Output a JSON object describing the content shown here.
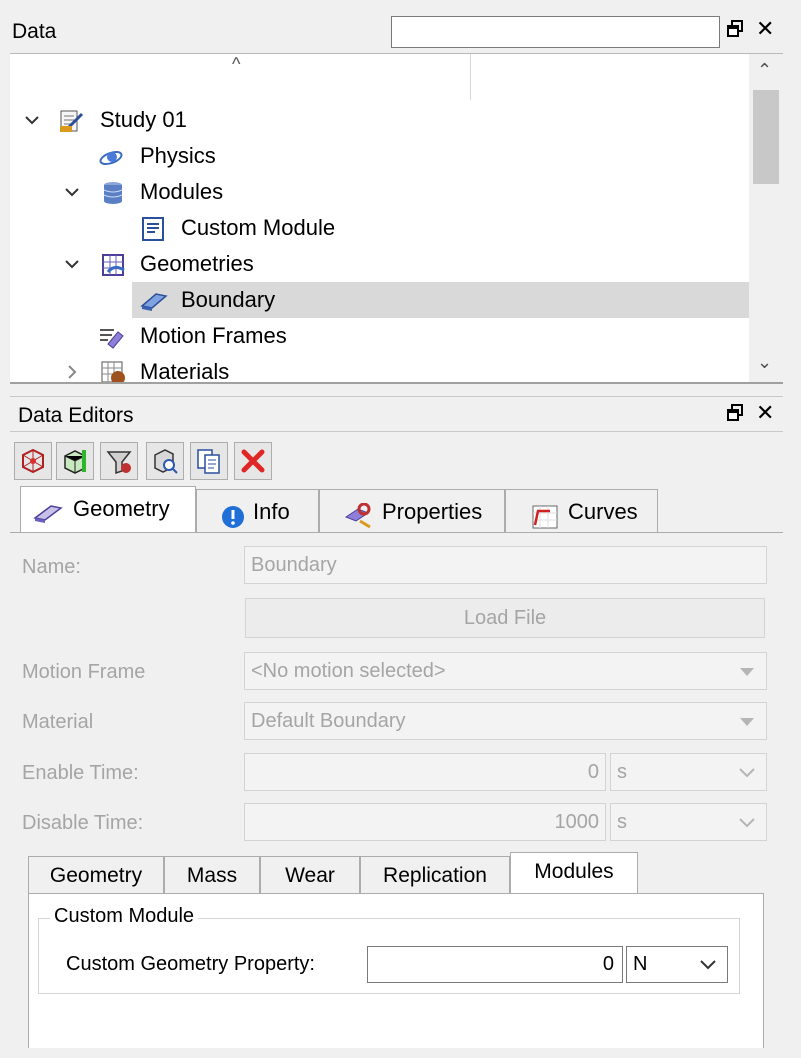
{
  "data_panel": {
    "title": "Data",
    "search_value": "",
    "tree": [
      {
        "label": "Study 01",
        "icon": "study-icon",
        "expanded": true
      },
      {
        "label": "Physics",
        "icon": "physics-icon"
      },
      {
        "label": "Modules",
        "icon": "modules-icon",
        "expanded": true
      },
      {
        "label": "Custom Module",
        "icon": "module-doc-icon"
      },
      {
        "label": "Geometries",
        "icon": "geometries-icon",
        "expanded": true
      },
      {
        "label": "Boundary",
        "icon": "boundary-icon",
        "selected": true
      },
      {
        "label": "Motion Frames",
        "icon": "motion-frames-icon"
      },
      {
        "label": "Materials",
        "icon": "materials-icon",
        "expanded": false
      }
    ]
  },
  "editors": {
    "title": "Data Editors",
    "toolbar": [
      "mesh-icon",
      "box-icon",
      "funnel-icon",
      "inspect-icon",
      "copy-icon",
      "delete-icon"
    ],
    "tabs": [
      {
        "label": "Geometry",
        "icon": "geometry-tab-icon",
        "active": true
      },
      {
        "label": "Info",
        "icon": "info-icon"
      },
      {
        "label": "Properties",
        "icon": "properties-icon"
      },
      {
        "label": "Curves",
        "icon": "curves-icon"
      }
    ],
    "fields": {
      "name_label": "Name:",
      "name_value": "Boundary",
      "load_file": "Load File",
      "motion_label": "Motion Frame",
      "motion_value": "<No motion selected>",
      "material_label": "Material",
      "material_value": "Default Boundary",
      "enable_label": "Enable Time:",
      "enable_value": "0",
      "enable_unit": "s",
      "disable_label": "Disable Time:",
      "disable_value": "1000",
      "disable_unit": "s"
    },
    "sub_tabs": [
      {
        "label": "Geometry"
      },
      {
        "label": "Mass"
      },
      {
        "label": "Wear"
      },
      {
        "label": "Replication"
      },
      {
        "label": "Modules",
        "active": true
      }
    ],
    "custom_module": {
      "title": "Custom Module",
      "prop_label": "Custom Geometry Property:",
      "prop_value": "0",
      "prop_unit": "N"
    }
  }
}
